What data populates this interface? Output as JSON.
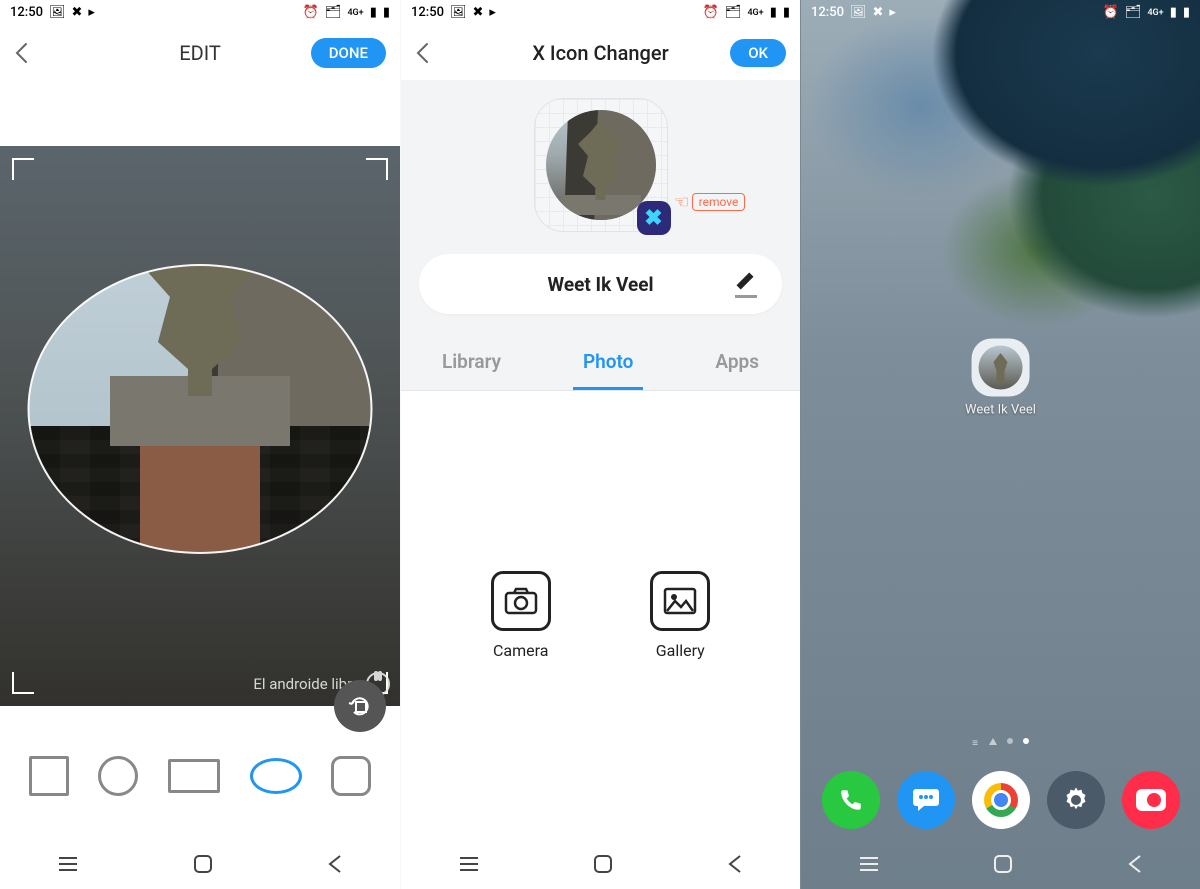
{
  "status": {
    "time": "12:50",
    "network_label": "4G+"
  },
  "screen1": {
    "title": "EDIT",
    "done": "DONE",
    "watermark": "El androide libre",
    "shapes": [
      "square",
      "circle",
      "rect",
      "oval",
      "rounded"
    ],
    "selected_shape_index": 3
  },
  "screen2": {
    "title": "X Icon Changer",
    "ok": "OK",
    "remove": "remove",
    "app_name": "Weet Ik Veel",
    "tabs": {
      "library": "Library",
      "photo": "Photo",
      "apps": "Apps",
      "active": "photo"
    },
    "options": {
      "camera": "Camera",
      "gallery": "Gallery"
    }
  },
  "screen3": {
    "shortcut_label": "Weet Ik Veel",
    "dock": [
      "phone",
      "messages",
      "chrome",
      "settings",
      "camera"
    ]
  }
}
